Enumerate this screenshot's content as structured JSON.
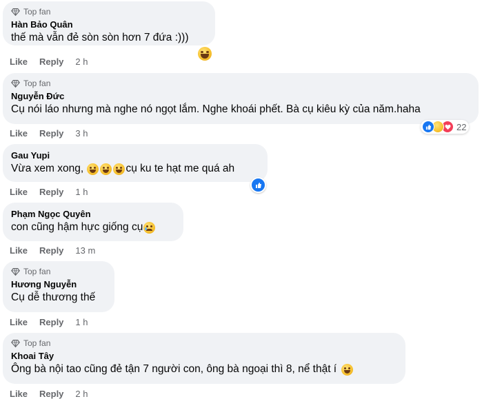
{
  "comments": [
    {
      "badge": "Top fan",
      "name": "Hàn Bảo Quân",
      "text": "thế mà vẫn đẻ sòn sòn hơn 7 đứa :)))",
      "like": "Like",
      "reply": "Reply",
      "time": "2 h"
    },
    {
      "badge": "Top fan",
      "name": "Nguyễn Đức",
      "text": "Cụ nói láo nhưng mà nghe nó ngọt lắm. Nghe khoái phết. Bà cụ kiêu kỳ của năm.haha",
      "like": "Like",
      "reply": "Reply",
      "time": "3 h",
      "reaction_count": "22"
    },
    {
      "name": "Gau Yupi",
      "text_before": "Vừa xem xong, ",
      "text_after": "cụ ku te hạt me quá ah",
      "like": "Like",
      "reply": "Reply",
      "time": "1 h"
    },
    {
      "name": "Phạm Ngọc Quyên",
      "text": "con cũng hậm hực giống cụ",
      "like": "Like",
      "reply": "Reply",
      "time": "13 m"
    },
    {
      "badge": "Top fan",
      "name": "Hương Nguyễn",
      "text": "Cụ dễ thương thế",
      "like": "Like",
      "reply": "Reply",
      "time": "1 h"
    },
    {
      "badge": "Top fan",
      "name": "Khoai Tây",
      "text": "Ông bà nội tao cũng đẻ tận 7 người con, ông bà ngoại thì 8, nể thật í",
      "like": "Like",
      "reply": "Reply",
      "time": "2 h"
    }
  ],
  "colors": {
    "bubble": "#f0f2f5",
    "meta": "#65676b",
    "like_blue": "#1877f2",
    "love_red": "#f33e58"
  }
}
